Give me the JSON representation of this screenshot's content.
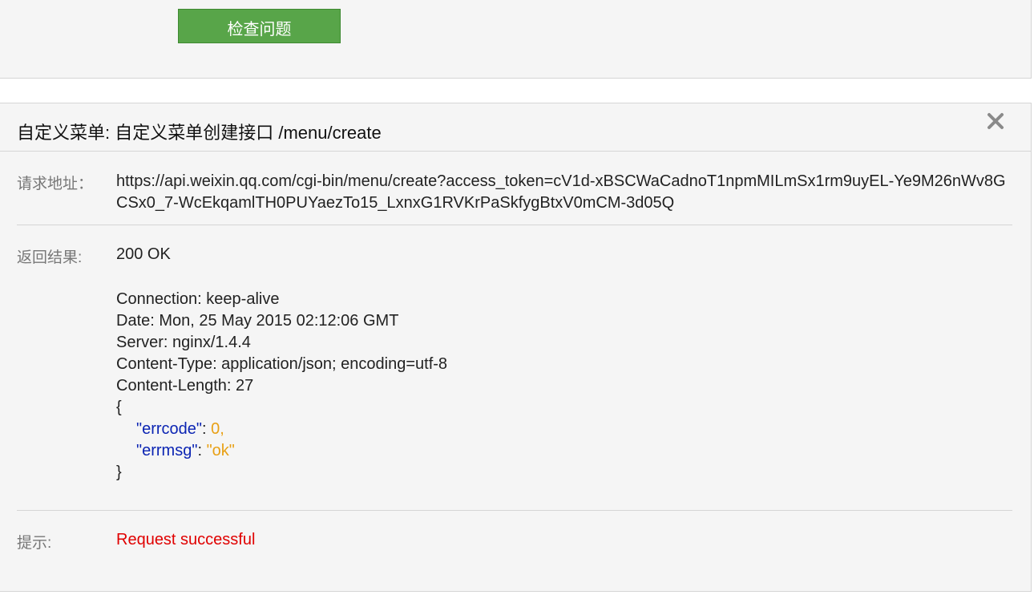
{
  "toolbar": {
    "check_button_label": "检查问题"
  },
  "panel": {
    "title": "自定义菜单: 自定义菜单创建接口 /menu/create",
    "close_icon": "close-icon",
    "request_url": {
      "label": "请求地址：",
      "value": "https://api.weixin.qq.com/cgi-bin/menu/create?access_token=cV1d-xBSCWaCadnoT1npmMILmSx1rm9uyEL-Ye9M26nWv8GCSx0_7-WcEkqamlTH0PUYaezTo15_LxnxG1RVKrPaSkfygBtxV0mCM-3d05Q"
    },
    "response": {
      "label": "返回结果:",
      "status": "200 OK",
      "headers": [
        "Connection: keep-alive",
        "Date: Mon, 25 May 2015 02:12:06 GMT",
        "Server: nginx/1.4.4",
        "Content-Type: application/json; encoding=utf-8",
        "Content-Length: 27"
      ],
      "json_open": "{",
      "json_close": "}",
      "errcode_key": "\"errcode\"",
      "errcode_value": "0,",
      "errmsg_key": "\"errmsg\"",
      "errmsg_value": "\"ok\"",
      "colon": ": "
    },
    "tip": {
      "label": "提示:",
      "value": "Request successful"
    }
  },
  "colors": {
    "button_green": "#58a549",
    "json_key": "#0b24b3",
    "json_value": "#e8a015",
    "success": "#e00000"
  }
}
